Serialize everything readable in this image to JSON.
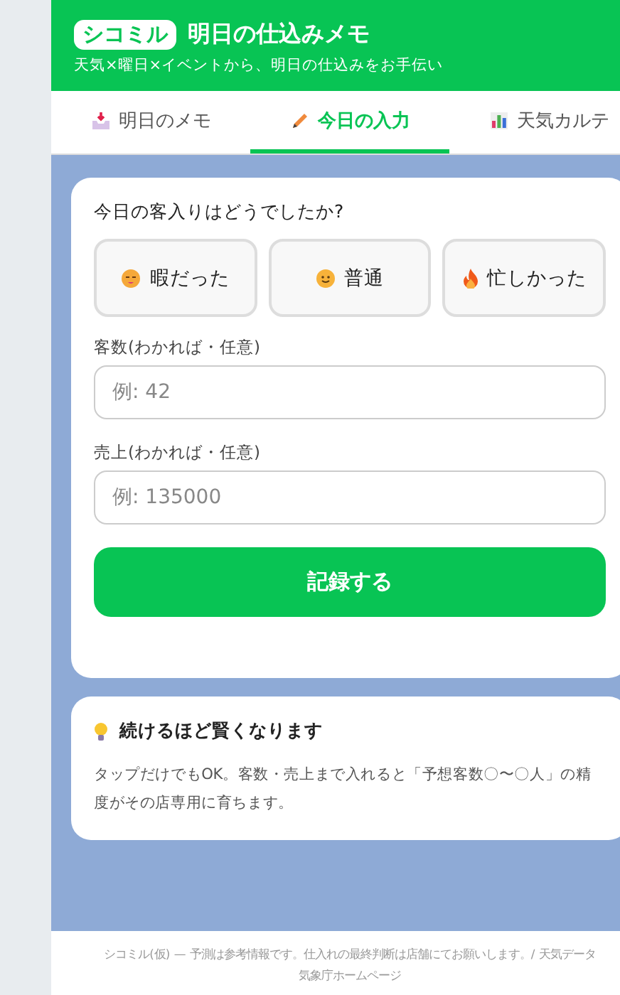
{
  "header": {
    "badge": "シコミル",
    "title": "明日の仕込みメモ",
    "subtitle": "天気×曜日×イベントから、明日の仕込みをお手伝い"
  },
  "tabs": [
    {
      "label": "明日のメモ",
      "selected": false
    },
    {
      "label": "今日の入力",
      "selected": true
    },
    {
      "label": "天気カルテ",
      "selected": false
    }
  ],
  "entry_card": {
    "question": "今日の客入りはどうでしたか?",
    "choices": [
      {
        "label": "暇だった",
        "selected": false
      },
      {
        "label": "普通",
        "selected": false
      },
      {
        "label": "忙しかった",
        "selected": false
      }
    ],
    "fields": [
      {
        "label": "客数(わかれば・任意)",
        "placeholder": "例: 42"
      },
      {
        "label": "売上(わかれば・任意)",
        "placeholder": "例: 135000"
      }
    ],
    "submit": "記録する"
  },
  "tip_card": {
    "title": "続けるほど賢くなります",
    "body": "タップだけでもOK。客数・売上まで入れると「予想客数〇〜〇人」の精度がその店専用に育ちます。"
  },
  "footer": {
    "lines": [
      "シコミル(仮) — 予測は参考情報です。仕入れの最終判断は店舗にてお願いします。/ 天気データ",
      "気象庁ホームページ"
    ]
  }
}
